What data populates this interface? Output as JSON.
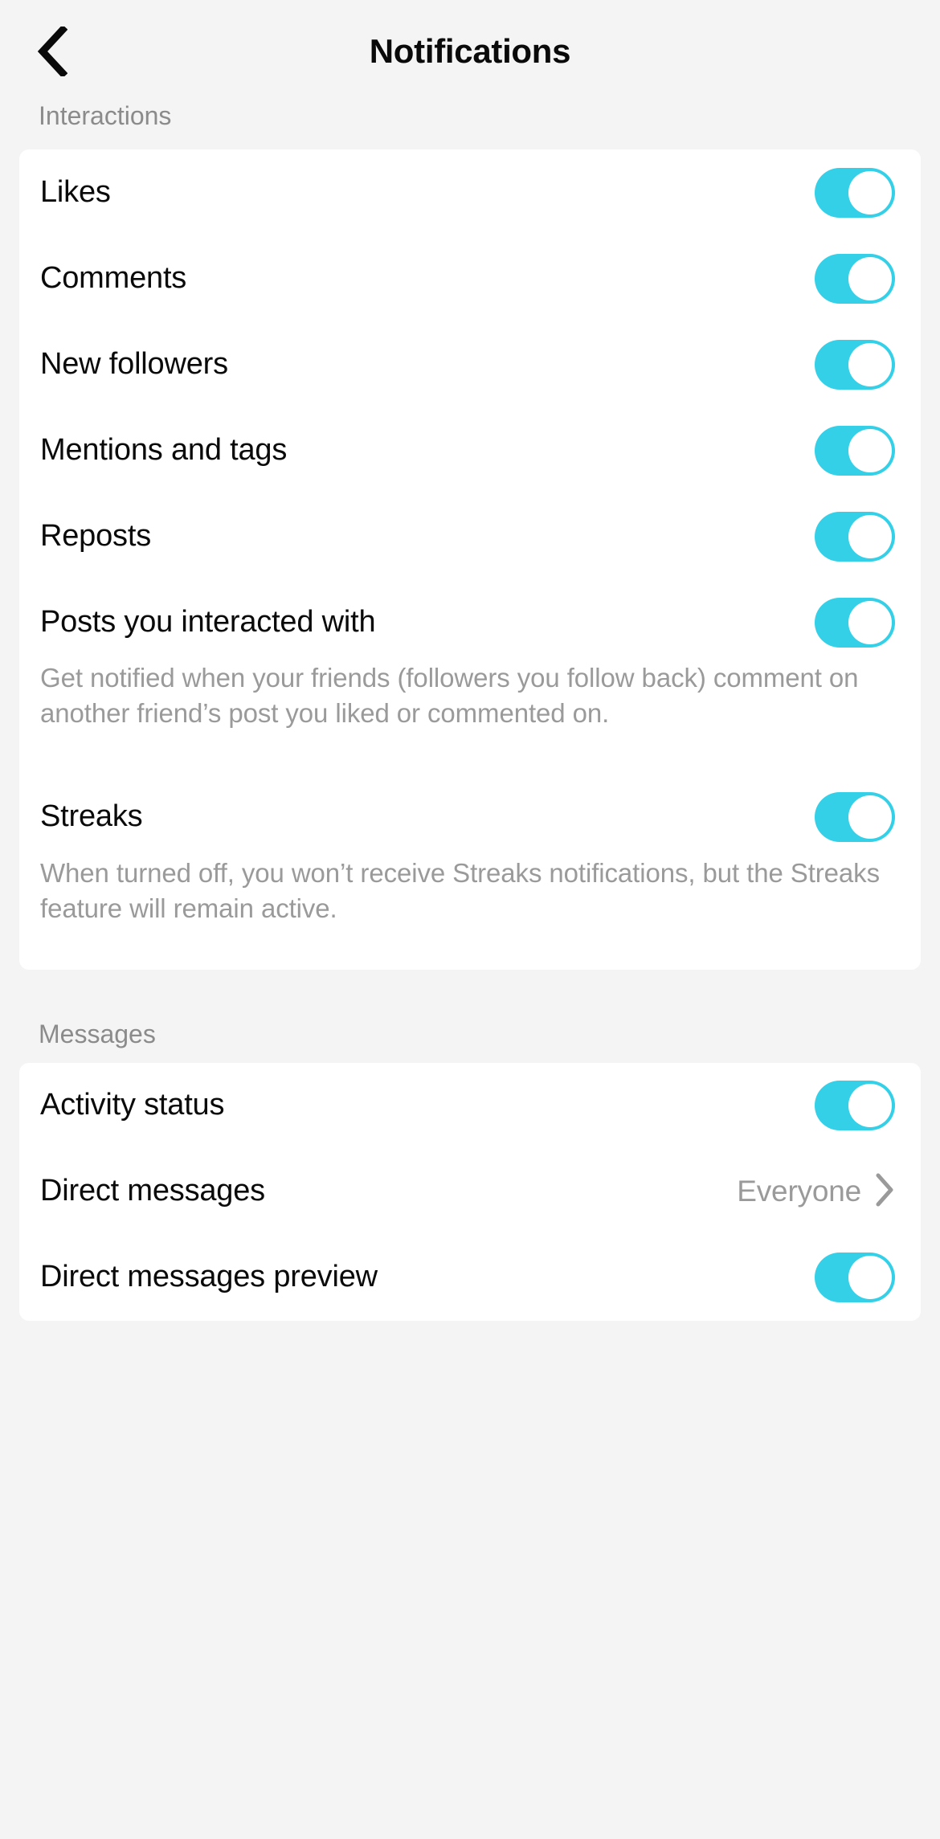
{
  "header": {
    "back_icon": "chevron-left-icon",
    "title": "Notifications"
  },
  "sections": [
    {
      "title": "Interactions",
      "rows": [
        {
          "label": "Likes",
          "type": "toggle",
          "toggle_on": true
        },
        {
          "label": "Comments",
          "type": "toggle",
          "toggle_on": true
        },
        {
          "label": "New followers",
          "type": "toggle",
          "toggle_on": true
        },
        {
          "label": "Mentions and tags",
          "type": "toggle",
          "toggle_on": true
        },
        {
          "label": "Reposts",
          "type": "toggle",
          "toggle_on": true
        },
        {
          "label": "Posts you interacted with",
          "type": "toggle",
          "toggle_on": true,
          "description": "Get notified when your friends (followers you follow back) comment on another friend’s post you liked or commented on."
        },
        {
          "label": "Streaks",
          "type": "toggle",
          "toggle_on": true,
          "description": "When turned off, you won’t receive Streaks notifications, but the Streaks feature will remain active."
        }
      ]
    },
    {
      "title": "Messages",
      "rows": [
        {
          "label": "Activity status",
          "type": "toggle",
          "toggle_on": true
        },
        {
          "label": "Direct messages",
          "type": "value",
          "value": "Everyone",
          "chevron": "chevron-right-icon"
        },
        {
          "label": "Direct messages preview",
          "type": "toggle",
          "toggle_on": true
        }
      ]
    }
  ],
  "colors": {
    "accent": "#34d0e8",
    "page_background": "#f4f4f4",
    "card_background": "#ffffff",
    "primary_text": "#0a0a0a",
    "secondary_text": "#9a9a9a"
  }
}
